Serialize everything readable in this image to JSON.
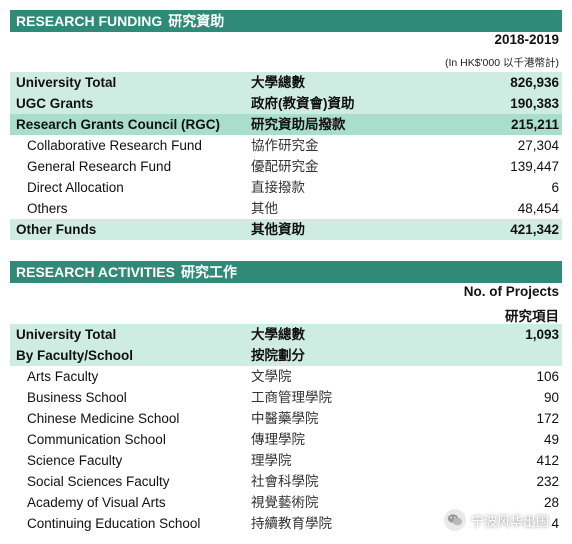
{
  "funding": {
    "title_en": "RESEARCH FUNDING",
    "title_zh": "研究資助",
    "year": "2018-2019",
    "unit": "(In HK$'000 以千港幣計)",
    "rows": [
      {
        "en": "University Total",
        "zh": "大學總數",
        "value": "826,936"
      },
      {
        "en": "UGC Grants",
        "zh": "政府(教資會)資助",
        "value": "190,383"
      },
      {
        "en": "Research Grants Council (RGC)",
        "zh": "研究資助局撥款",
        "value": "215,211"
      },
      {
        "en": "Collaborative Research Fund",
        "zh": "協作研究金",
        "value": "27,304"
      },
      {
        "en": "General Research Fund",
        "zh": "優配研究金",
        "value": "139,447"
      },
      {
        "en": "Direct Allocation",
        "zh": "直接撥款",
        "value": "6"
      },
      {
        "en": "Others",
        "zh": "其他",
        "value": "48,454"
      },
      {
        "en": "Other Funds",
        "zh": "其他資助",
        "value": "421,342"
      }
    ]
  },
  "activities": {
    "title_en": "RESEARCH ACTIVITIES",
    "title_zh": "研究工作",
    "col_en": "No. of Projects",
    "col_zh": "研究項目",
    "rows": [
      {
        "en": "University Total",
        "zh": "大學總數",
        "value": "1,093"
      },
      {
        "en": "By Faculty/School",
        "zh": "按院劃分",
        "value": ""
      },
      {
        "en": "Arts Faculty",
        "zh": "文學院",
        "value": "106"
      },
      {
        "en": "Business School",
        "zh": "工商管理學院",
        "value": "90"
      },
      {
        "en": "Chinese Medicine School",
        "zh": "中醫藥學院",
        "value": "172"
      },
      {
        "en": "Communication School",
        "zh": "傳理學院",
        "value": "49"
      },
      {
        "en": "Science Faculty",
        "zh": "理學院",
        "value": "412"
      },
      {
        "en": "Social Sciences Faculty",
        "zh": "社會科學院",
        "value": "232"
      },
      {
        "en": "Academy of Visual Arts",
        "zh": "視覺藝術院",
        "value": "28"
      },
      {
        "en": "Continuing Education School",
        "zh": "持續教育學院",
        "value": "4"
      }
    ]
  },
  "watermark": {
    "text": "宁波风华出国"
  },
  "colors": {
    "header": "#2f8a77",
    "band_light": "#cfece3",
    "band_mid": "#a9ddcc"
  }
}
